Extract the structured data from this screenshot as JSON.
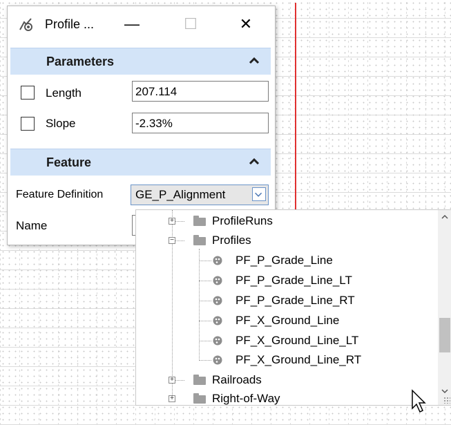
{
  "dialog": {
    "title": "Profile ...",
    "min_glyph": "—",
    "max_glyph": "☐",
    "close_glyph": "✕",
    "icon": "profile-tool-icon"
  },
  "parameters": {
    "header": "Parameters",
    "length": {
      "label": "Length",
      "value": "207.114",
      "checked": false
    },
    "slope": {
      "label": "Slope",
      "value": "-2.33%",
      "checked": false
    }
  },
  "feature": {
    "header": "Feature",
    "definition_label": "Feature Definition",
    "definition_value": "GE_P_Alignment",
    "name_label": "Name"
  },
  "tree": {
    "items": [
      {
        "label": "ProfileRuns",
        "kind": "folder",
        "expanded": false
      },
      {
        "label": "Profiles",
        "kind": "folder",
        "expanded": true
      },
      {
        "label": "PF_P_Grade_Line",
        "kind": "feature"
      },
      {
        "label": "PF_P_Grade_Line_LT",
        "kind": "feature"
      },
      {
        "label": "PF_P_Grade_Line_RT",
        "kind": "feature"
      },
      {
        "label": "PF_X_Ground_Line",
        "kind": "feature"
      },
      {
        "label": "PF_X_Ground_Line_LT",
        "kind": "feature"
      },
      {
        "label": "PF_X_Ground_Line_RT",
        "kind": "feature"
      },
      {
        "label": "Railroads",
        "kind": "folder",
        "expanded": false
      },
      {
        "label": "Right-of-Way",
        "kind": "folder",
        "expanded": false
      }
    ]
  },
  "colors": {
    "section_header": "#d3e4f8",
    "red_guide": "#e03030",
    "combo_border": "#6a93c8"
  }
}
